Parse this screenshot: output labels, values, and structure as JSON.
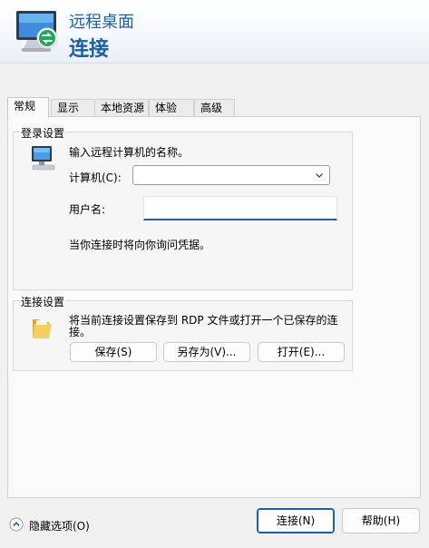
{
  "header": {
    "app_name": "远程桌面",
    "heading": "连接",
    "app_icon": "remote-desktop-icon"
  },
  "tabs": [
    {
      "label": "常规",
      "active": true
    },
    {
      "label": "显示",
      "active": false
    },
    {
      "label": "本地资源",
      "active": false
    },
    {
      "label": "体验",
      "active": false
    },
    {
      "label": "高级",
      "active": false
    }
  ],
  "login_settings": {
    "group_title": "登录设置",
    "icon": "computer-icon",
    "instruction": "输入远程计算机的名称。",
    "computer_label": "计算机(C):",
    "computer_value": "",
    "username_label": "用户名:",
    "username_value": "",
    "credential_note": "当你连接时将向你询问凭据。"
  },
  "connection_settings": {
    "group_title": "连接设置",
    "icon": "folder-icon",
    "description_line1": "将当前连接设置保存到 RDP 文件或打开一个已保存的连",
    "description_line2": "接。",
    "save_button": "保存(S)",
    "save_as_button": "另存为(V)...",
    "open_button": "打开(E)..."
  },
  "footer": {
    "hide_options": "隐藏选项(O)",
    "connect_button": "连接(N)",
    "help_button": "帮助(H)"
  },
  "colors": {
    "accent": "#1b5fa7",
    "background": "#f0f0f0",
    "panel": "#fafafa"
  }
}
